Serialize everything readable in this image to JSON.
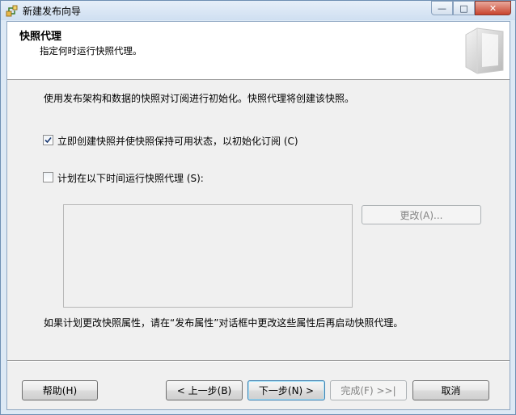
{
  "window": {
    "title": "新建发布向导",
    "minimize_glyph": "—",
    "maximize_glyph": "□",
    "close_glyph": "✕"
  },
  "header": {
    "title": "快照代理",
    "subtitle": "指定何时运行快照代理。"
  },
  "body": {
    "intro": "使用发布架构和数据的快照对订阅进行初始化。快照代理将创建该快照。",
    "checkbox_immediate": {
      "label": "立即创建快照并使快照保持可用状态，以初始化订阅 (C)",
      "checked": true
    },
    "checkbox_schedule": {
      "label": "计划在以下时间运行快照代理 (S):",
      "checked": false
    },
    "change_button": "更改(A)...",
    "footnote": "如果计划更改快照属性，请在“发布属性”对话框中更改这些属性后再启动快照代理。"
  },
  "footer": {
    "help": "帮助(H)",
    "back": "< 上一步(B)",
    "next": "下一步(N) >",
    "finish": "完成(F) >>|",
    "cancel": "取消"
  }
}
